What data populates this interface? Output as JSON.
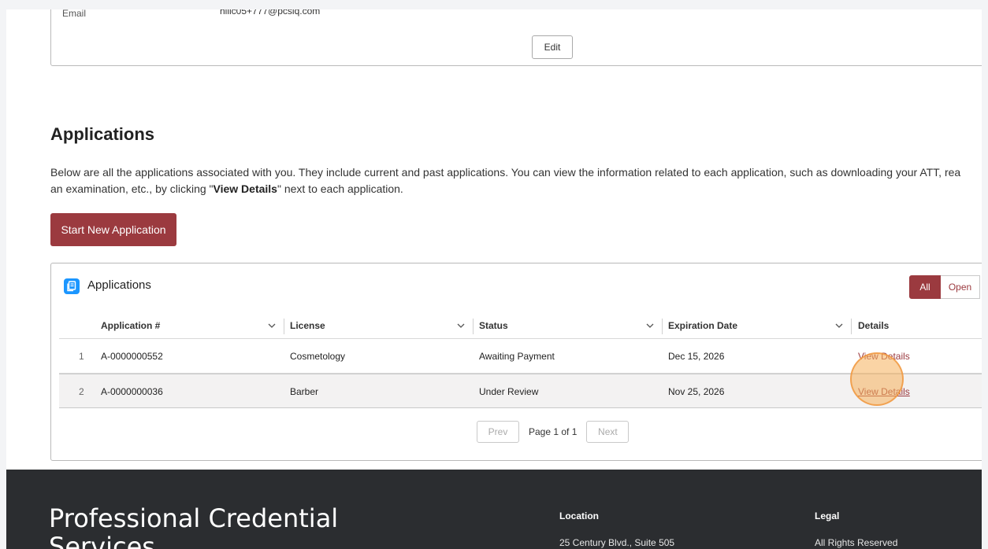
{
  "profile": {
    "email_label": "Email",
    "email_value": "hlllc05+777@pcsiq.com",
    "edit_label": "Edit"
  },
  "applications_section": {
    "title": "Applications",
    "desc_part1": "Below are all the applications associated with you. They include current and past applications. You can view the information related to each application, such as downloading your ATT, rea",
    "desc_part2": "an examination, etc., by clicking \"",
    "desc_bold": "View Details",
    "desc_part3": "\" next to each application.",
    "start_button": "Start New Application"
  },
  "apps_card": {
    "header": "Applications",
    "filters": [
      "All",
      "Open"
    ],
    "columns": [
      "Application #",
      "License",
      "Status",
      "Expiration Date",
      "Details"
    ],
    "rows": [
      {
        "num": "1",
        "app": "A-0000000552",
        "license": "Cosmetology",
        "status": "Awaiting Payment",
        "expiration": "Dec 15, 2026",
        "details": "View Details"
      },
      {
        "num": "2",
        "app": "A-0000000036",
        "license": "Barber",
        "status": "Under Review",
        "expiration": "Nov 25, 2026",
        "details": "View Details"
      }
    ],
    "pager": {
      "prev": "Prev",
      "label": "Page 1 of 1",
      "next": "Next"
    }
  },
  "footer": {
    "brand_line1": "Professional Credential",
    "brand_line2": "Services",
    "location_title": "Location",
    "location_text": "25 Century Blvd., Suite 505",
    "legal_title": "Legal",
    "legal_text": "All Rights Reserved"
  },
  "colors": {
    "accent": "#9b3a3f",
    "footer_bg": "#2b2d30",
    "icon_blue": "#1b96ff",
    "click_highlight": "#f6b05b"
  }
}
